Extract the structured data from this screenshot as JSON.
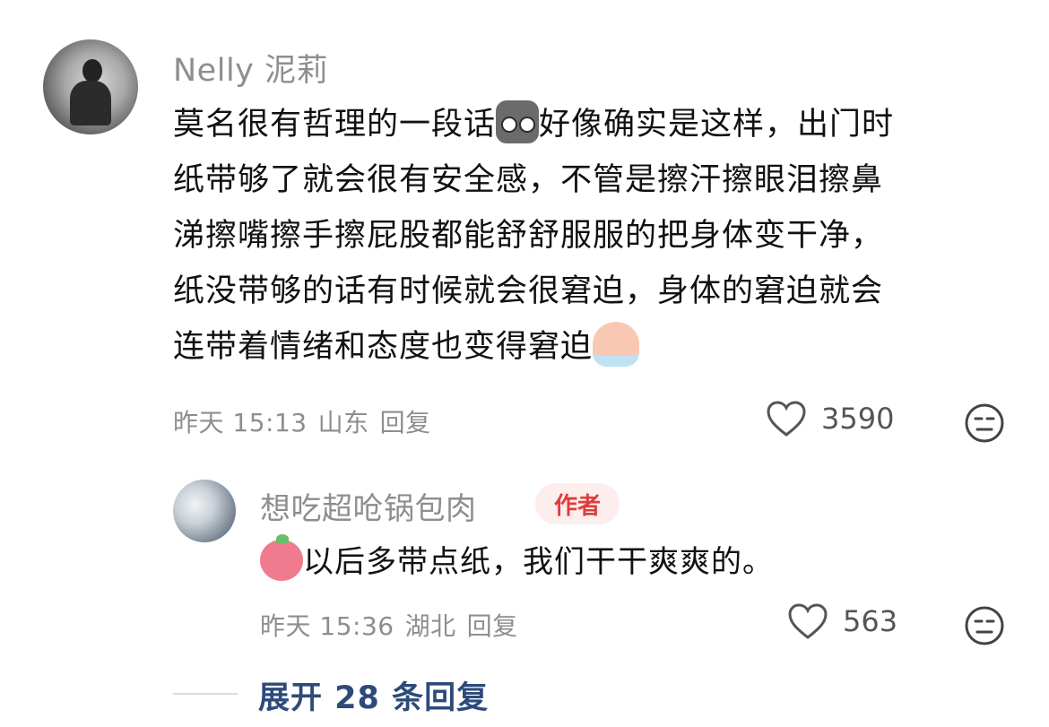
{
  "main_comment": {
    "username": "Nelly 泥莉",
    "text_lines": [
      "莫名很有哲理的一段话",
      "好像确实是这样，出门时",
      "纸带够了就会很有安全感，不管是擦汗擦眼泪擦鼻",
      "涕擦嘴擦手擦屁股都能舒舒服服的把身体变干净，",
      "纸没带够的话有时候就会很窘迫，身体的窘迫就会",
      "连带着情绪和态度也变得窘迫"
    ],
    "inline_emoji": [
      "cat-emoji",
      "crying-emoji"
    ],
    "time": "昨天 15:13",
    "location": "山东",
    "reply_label": "回复",
    "likes": "3590"
  },
  "reply": {
    "username": "想吃超呛锅包肉",
    "badge": "作者",
    "text": "以后多带点纸，我们干干爽爽的。",
    "inline_emoji": "pink-mascot-emoji",
    "time": "昨天 15:36",
    "location": "湖北",
    "reply_label": "回复",
    "likes": "563"
  },
  "expand": {
    "label": "展开 28 条回复"
  },
  "icons": {
    "like": "heart-outline-icon",
    "dislike": "meh-face-icon"
  }
}
